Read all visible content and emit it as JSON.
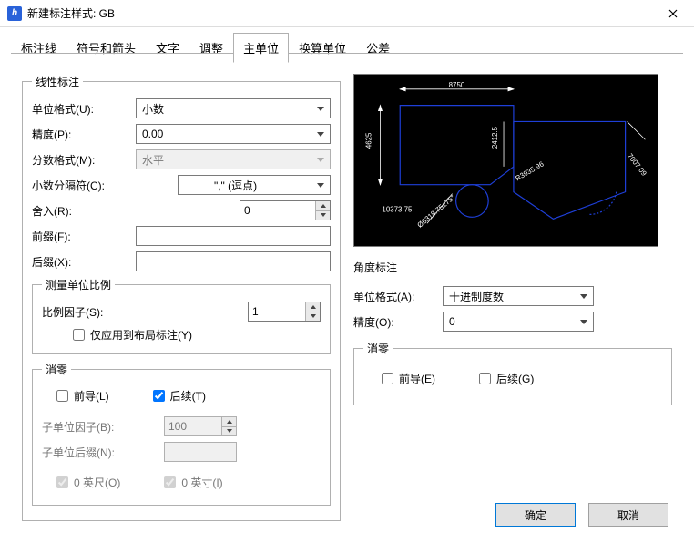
{
  "title": "新建标注样式: GB",
  "app_icon_letter": "h",
  "tabs": {
    "t0": "标注线",
    "t1": "符号和箭头",
    "t2": "文字",
    "t3": "调整",
    "t4": "主单位",
    "t5": "换算单位",
    "t6": "公差"
  },
  "active_tab": "t4",
  "linear": {
    "legend": "线性标注",
    "unit_format": {
      "label": "单位格式(U):",
      "value": "小数"
    },
    "precision": {
      "label": "精度(P):",
      "value": "0.00"
    },
    "fraction_format": {
      "label": "分数格式(M):",
      "value": "水平"
    },
    "decimal_sep": {
      "label": "小数分隔符(C):",
      "value": "\",\" (逗点)"
    },
    "round": {
      "label": "舍入(R):",
      "value": "0"
    },
    "prefix": {
      "label": "前缀(F):",
      "value": ""
    },
    "suffix": {
      "label": "后缀(X):",
      "value": ""
    },
    "scale": {
      "legend": "测量单位比例",
      "factor": {
        "label": "比例因子(S):",
        "value": "1"
      },
      "layout_only": "仅应用到布局标注(Y)"
    },
    "zero": {
      "legend": "消零",
      "leading": "前导(L)",
      "trailing": "后续(T)",
      "subunit_factor": {
        "label": "子单位因子(B):",
        "value": "100"
      },
      "subunit_suffix": {
        "label": "子单位后缀(N):",
        "value": ""
      },
      "feet": "0 英尺(O)",
      "inches": "0 英寸(I)"
    }
  },
  "angle": {
    "heading": "角度标注",
    "unit_format": {
      "label": "单位格式(A):",
      "value": "十进制度数"
    },
    "precision": {
      "label": "精度(O):",
      "value": "0"
    },
    "zero": {
      "legend": "消零",
      "leading": "前导(E)",
      "trailing": "后续(G)"
    }
  },
  "preview": {
    "dim_top": "8750",
    "dim_left": "4625",
    "dim_mid": "2412.5",
    "dim_radius": "R3935.96",
    "dim_angle": "Ø6318.75±75°",
    "dim_bottom": "10373.75",
    "dim_right": "7007.09"
  },
  "buttons": {
    "ok": "确定",
    "cancel": "取消"
  }
}
